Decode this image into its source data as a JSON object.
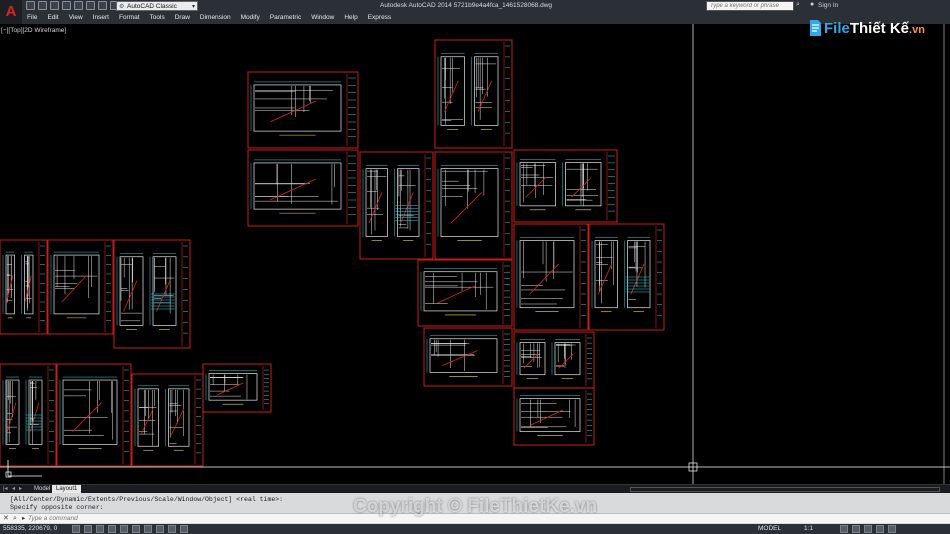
{
  "window": {
    "title": "Autodesk AutoCAD 2014   5721b9e4a4fca_1461528068.dwg",
    "workspace": "AutoCAD Classic"
  },
  "search": {
    "placeholder": "Type a keyword or phrase"
  },
  "account": {
    "sign_in": "Sign In"
  },
  "menu": [
    "File",
    "Edit",
    "View",
    "Insert",
    "Format",
    "Tools",
    "Draw",
    "Dimension",
    "Modify",
    "Parametric",
    "Window",
    "Help",
    "Express"
  ],
  "viewport": {
    "label": "[−][Top][2D Wireframe]"
  },
  "layout_tabs": {
    "model": "Model",
    "layout1": "Layout1"
  },
  "command": {
    "history": [
      "[All/Center/Dynamic/Extents/Previous/Scale/Window/Object] <real time>:",
      "Specify opposite corner:"
    ],
    "prompt": "▸",
    "placeholder": "Type a command"
  },
  "status": {
    "coords": "558335, 220679, 0",
    "model": "MODEL",
    "scale": "1:1"
  },
  "watermark": {
    "brand_file": "File",
    "brand_rest": "Thiết Kế",
    "brand_domain": ".vn",
    "copyright": "Copyright © FileThietKe.vn"
  },
  "colors": {
    "frame": "#e02020",
    "linework": "#e8e8e8",
    "text": "#27d4e0",
    "accent": "#f0e040",
    "crosshair": "#ffffff",
    "background": "#000000"
  }
}
